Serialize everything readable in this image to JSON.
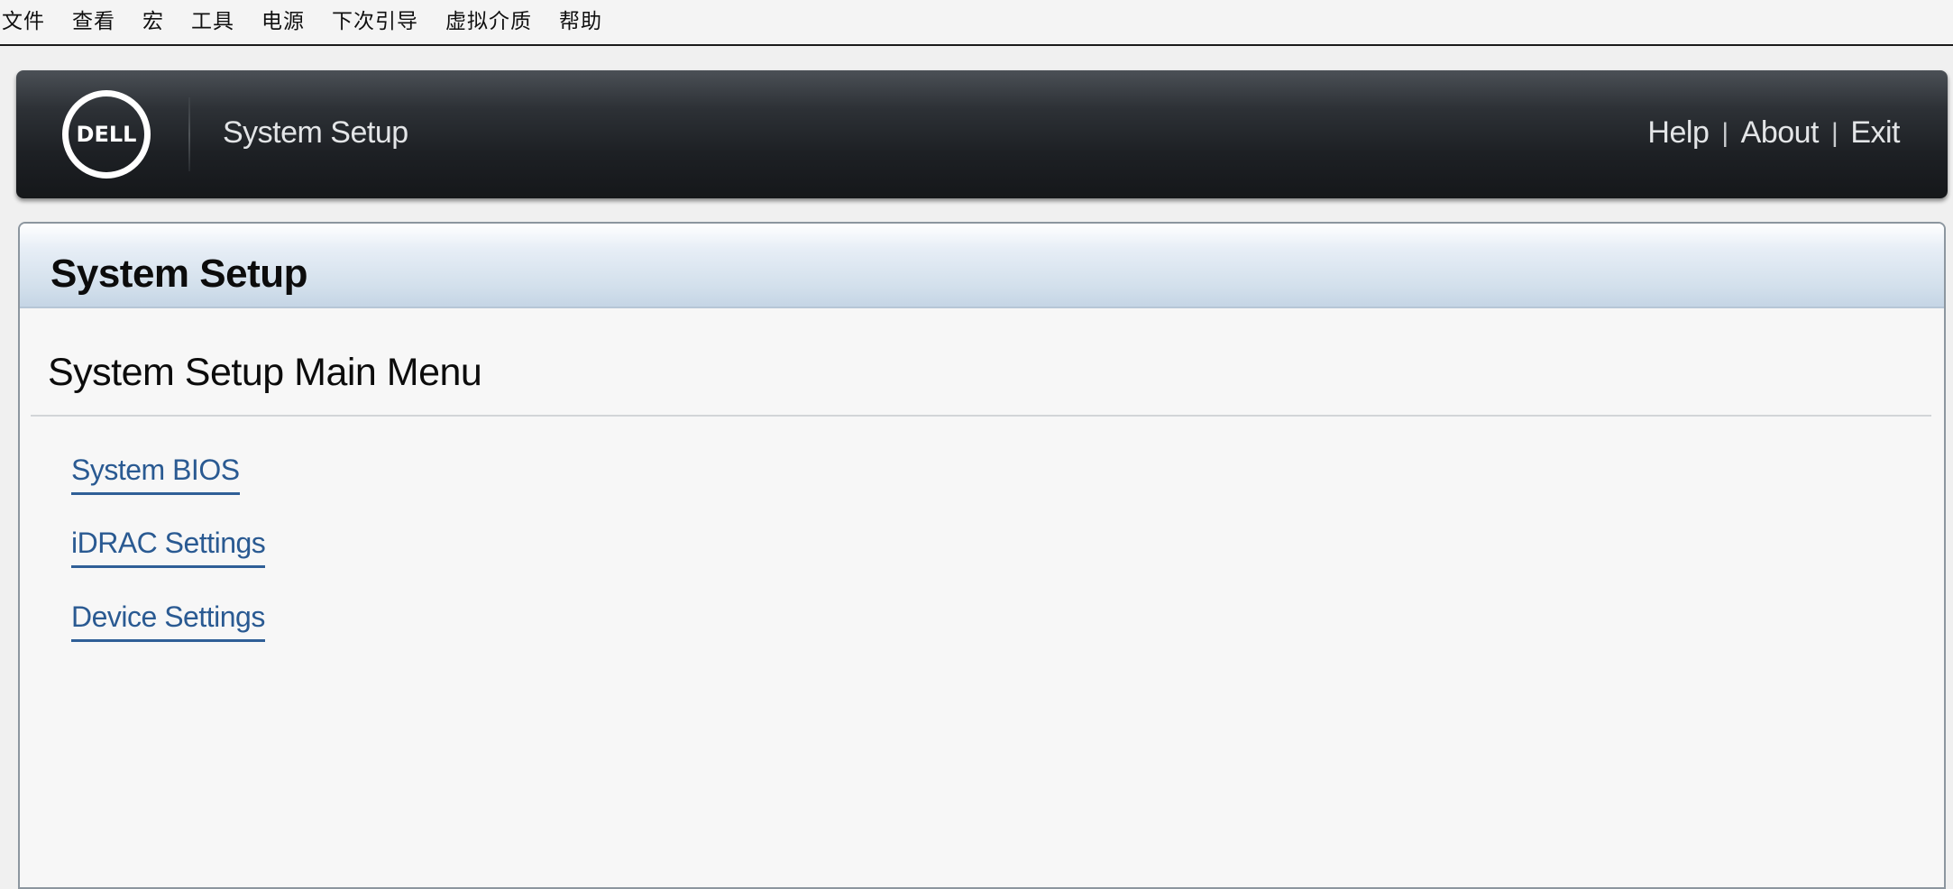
{
  "menubar": {
    "items": [
      "文件",
      "查看",
      "宏",
      "工具",
      "电源",
      "下次引导",
      "虚拟介质",
      "帮助"
    ]
  },
  "header": {
    "logo_text": "DELL",
    "title": "System Setup",
    "links": {
      "help": "Help",
      "about": "About",
      "exit": "Exit",
      "separator": "|"
    }
  },
  "panel": {
    "title": "System Setup",
    "section_title": "System Setup Main Menu",
    "menu_links": [
      "System BIOS",
      "iDRAC Settings",
      "Device Settings"
    ]
  },
  "colors": {
    "link": "#2a5a92",
    "header_bg": "#1d2024",
    "panel_header_bg": "#d3e0ec"
  }
}
